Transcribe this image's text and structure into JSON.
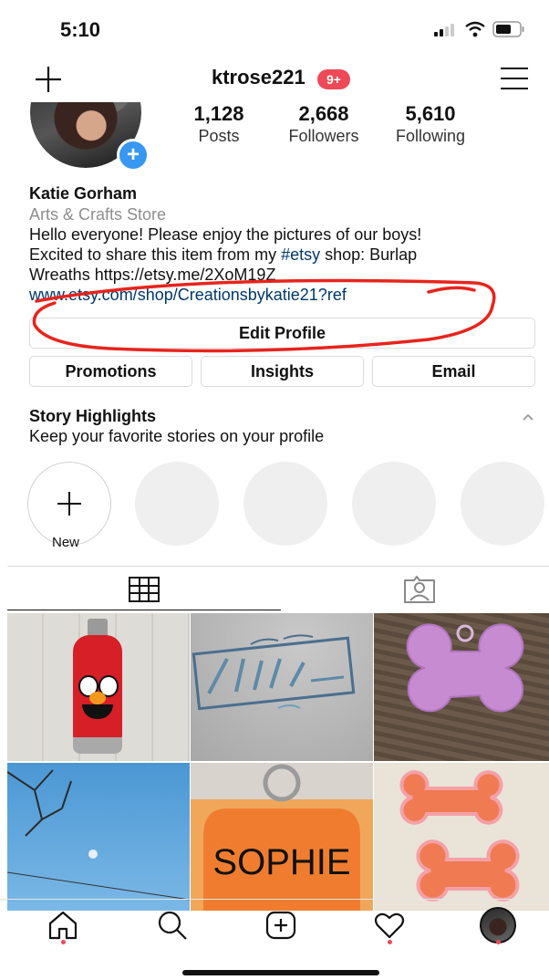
{
  "status": {
    "time": "5:10"
  },
  "header": {
    "username": "ktrose221",
    "badge": "9+"
  },
  "stats": [
    {
      "value": "1,128",
      "label": "Posts"
    },
    {
      "value": "2,668",
      "label": "Followers"
    },
    {
      "value": "5,610",
      "label": "Following"
    }
  ],
  "profile": {
    "name": "Katie Gorham",
    "category": "Arts & Crafts Store",
    "bio_line1": "Hello everyone! Please enjoy the pictures of our boys!",
    "bio_line2_prefix": "Excited to share this item from my ",
    "bio_line2_tag": "#etsy",
    "bio_line2_suffix": " shop: Burlap",
    "bio_line3": "Wreaths https://etsy.me/2XoM19Z",
    "website": "www.etsy.com/shop/Creationsbykatie21?ref"
  },
  "buttons": {
    "edit_profile": "Edit Profile",
    "promotions": "Promotions",
    "insights": "Insights",
    "email": "Email"
  },
  "highlights": {
    "title": "Story Highlights",
    "subtitle": "Keep your favorite stories on your profile",
    "new_label": "New"
  },
  "icons": {
    "status": [
      "signal-icon",
      "wifi-icon",
      "battery-icon"
    ],
    "header": [
      "plus-icon",
      "menu-icon"
    ],
    "tabs": [
      "grid-icon",
      "tagged-icon"
    ],
    "nav": [
      "home-icon",
      "search-icon",
      "add-post-icon",
      "heart-icon",
      "profile-avatar"
    ]
  },
  "colors": {
    "badge": "#ed4956",
    "accent": "#3897f0",
    "annotation": "#e8241c"
  }
}
